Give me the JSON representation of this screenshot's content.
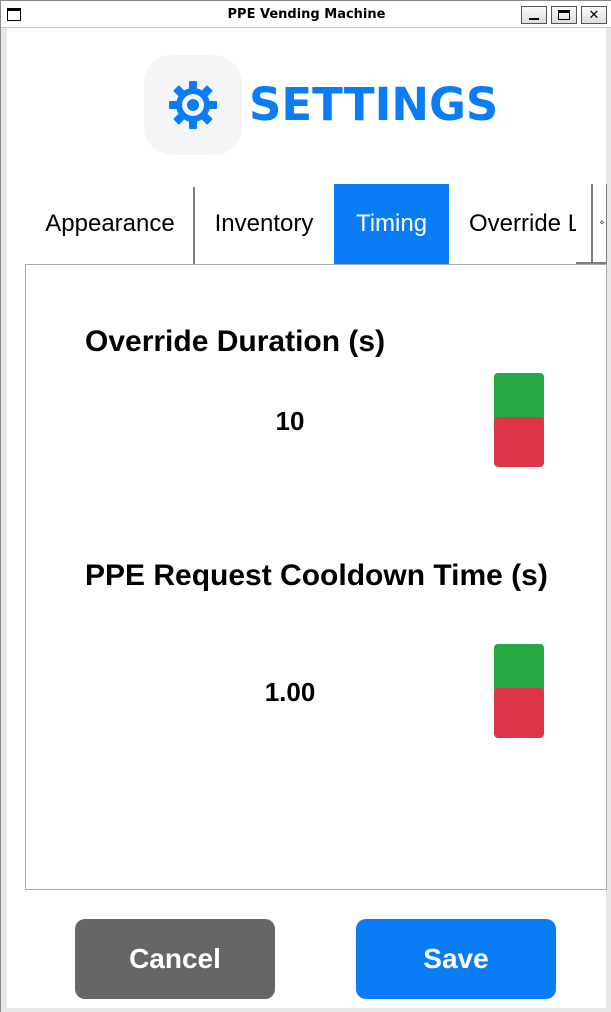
{
  "window": {
    "title": "PPE Vending Machine",
    "close_glyph": "✕"
  },
  "header": {
    "icon": "gear-icon",
    "title": "SETTINGS",
    "accent_color": "#0a7cf5"
  },
  "tabs": [
    {
      "label": "Appearance",
      "selected": false
    },
    {
      "label": "Inventory",
      "selected": false
    },
    {
      "label": "Timing",
      "selected": true
    },
    {
      "label": "Override L",
      "selected": false
    }
  ],
  "tab_scroll": {
    "arrows": "‹›"
  },
  "settings": [
    {
      "label": "Override Duration (s)",
      "value": "10"
    },
    {
      "label": "PPE Request Cooldown Time (s)",
      "value": "1.00"
    }
  ],
  "stepper_colors": {
    "increase": "#28a745",
    "decrease": "#dc3545"
  },
  "footer": {
    "cancel_label": "Cancel",
    "save_label": "Save"
  }
}
